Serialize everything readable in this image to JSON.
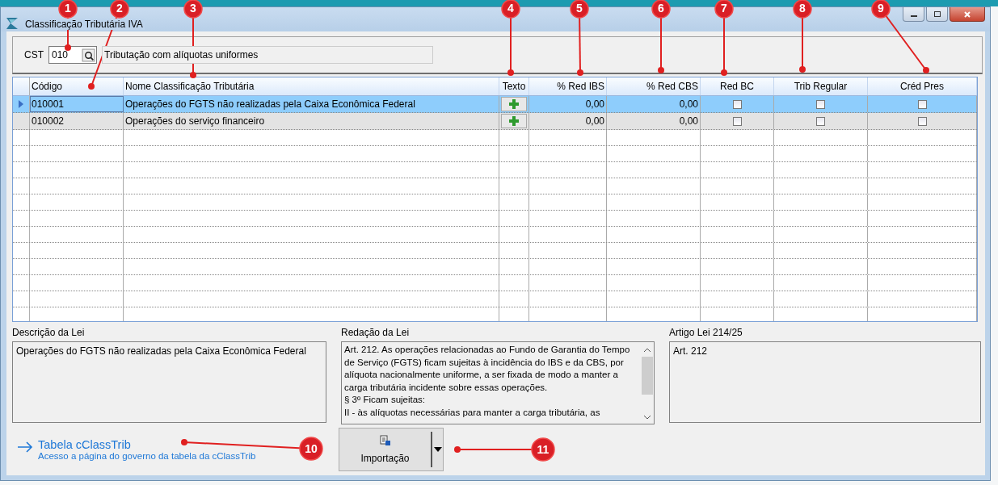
{
  "window": {
    "title": "Classificação Tributária IVA"
  },
  "cst": {
    "label": "CST",
    "value": "010",
    "description": "Tributação com alíquotas uniformes"
  },
  "table": {
    "columns": [
      "Código",
      "Nome Classificação Tributária",
      "Texto",
      "% Red IBS",
      "% Red CBS",
      "Red BC",
      "Trib Regular",
      "Créd Pres"
    ],
    "rows": [
      {
        "selected": true,
        "codigo": "010001",
        "nome": "Operações do FGTS não realizadas pela Caixa Econômica Federal",
        "red_ibs": "0,00",
        "red_cbs": "0,00",
        "red_bc": false,
        "trib_regular": false,
        "cred_pres": false
      },
      {
        "selected": false,
        "codigo": "010002",
        "nome": "Operações do serviço financeiro",
        "red_ibs": "0,00",
        "red_cbs": "0,00",
        "red_bc": false,
        "trib_regular": false,
        "cred_pres": false
      }
    ]
  },
  "descricao": {
    "label": "Descrição da Lei",
    "text": "Operações do FGTS não realizadas pela Caixa Econômica Federal"
  },
  "redacao": {
    "label": "Redação da Lei",
    "lines": [
      "Art. 212. As operações relacionadas ao Fundo de Garantia do Tempo de Serviço (FGTS) ficam sujeitas à incidência do IBS e da CBS, por alíquota nacionalmente uniforme, a ser fixada de modo a manter a carga tributária incidente sobre essas operações.",
      "§ 3º Ficam sujeitas:",
      "II - às alíquotas necessárias para manter a carga tributária, as"
    ]
  },
  "artigo": {
    "label": "Artigo Lei 214/25",
    "text": "Art. 212"
  },
  "link": {
    "title": "Tabela cClassTrib",
    "subtitle": "Acesso a página do governo da tabela da cClassTrib"
  },
  "import_button": {
    "label": "Importação"
  },
  "annotations": [
    "1",
    "2",
    "3",
    "4",
    "5",
    "6",
    "7",
    "8",
    "9",
    "10",
    "11"
  ]
}
